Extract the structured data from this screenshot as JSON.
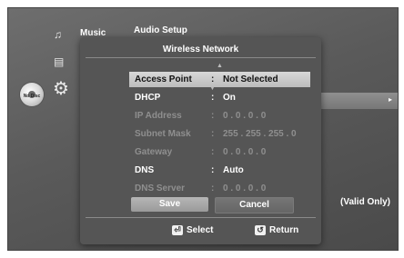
{
  "background": {
    "music_label": "Music",
    "audio_setup_label": "Audio Setup",
    "no_disc_label": "No Disc",
    "valid_only_label": "(Valid Only)",
    "arrow_glyph": "▸"
  },
  "dialog": {
    "title": "Wireless Network",
    "rows": [
      {
        "label": "Access Point",
        "colon": ":",
        "value": "Not Selected"
      },
      {
        "label": "DHCP",
        "colon": ":",
        "value": "On"
      },
      {
        "label": "IP Address",
        "colon": ":",
        "value": "0 . 0 . 0 . 0"
      },
      {
        "label": "Subnet Mask",
        "colon": ":",
        "value": "255 . 255 . 255 . 0"
      },
      {
        "label": "Gateway",
        "colon": ":",
        "value": "0 . 0 . 0 . 0"
      },
      {
        "label": "DNS",
        "colon": ":",
        "value": "Auto"
      },
      {
        "label": "DNS Server",
        "colon": ":",
        "value": "0 . 0 . 0 . 0"
      }
    ],
    "buttons": {
      "save": "Save",
      "cancel": "Cancel"
    },
    "footer": {
      "select": "Select",
      "return": "Return"
    }
  },
  "colors": {
    "selected_row": "#cfcfcf",
    "panel": "#555555"
  },
  "icons": [
    "music-note-icon",
    "photo-icon",
    "disc-icon",
    "gear-icon",
    "select-key-icon",
    "return-key-icon",
    "scroll-up-icon",
    "scroll-down-icon"
  ]
}
